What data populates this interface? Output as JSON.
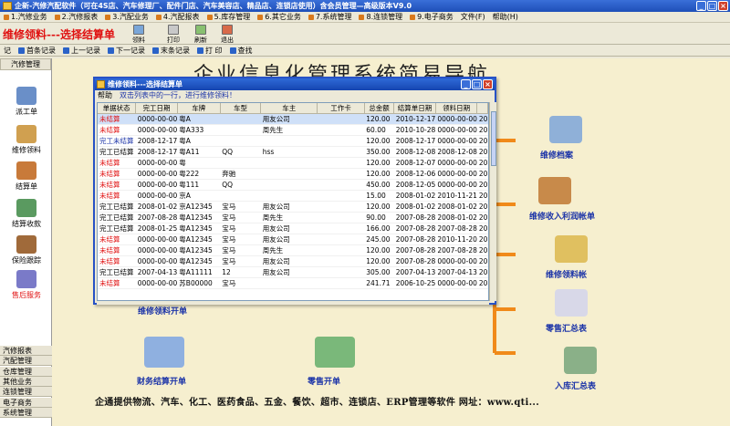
{
  "window": {
    "title": "企新-汽修汽配软件（可在4S店、汽车修理厂、配件门店、汽车美容店、精品店、连锁店使用）含会员管理—高级版本V9.0"
  },
  "menu": [
    {
      "label": "1.汽修业务"
    },
    {
      "label": "2.汽修报表"
    },
    {
      "label": "3.汽配业务"
    },
    {
      "label": "4.汽配报表"
    },
    {
      "label": "5.库存管理"
    },
    {
      "label": "6.其它业务"
    },
    {
      "label": "7.系统管理"
    },
    {
      "label": "8.连锁管理"
    },
    {
      "label": "9.电子商务"
    },
    {
      "label": "文件(F)",
      "plain": true
    },
    {
      "label": "帮助(H)",
      "plain": true
    }
  ],
  "toolbar": {
    "banner": "维修领料---选择结算单",
    "buttons": [
      {
        "label": "领料",
        "icon": "pick-material-icon"
      },
      {
        "label": "打印",
        "icon": "print-icon"
      },
      {
        "label": "刷新",
        "icon": "refresh-icon"
      },
      {
        "label": "退出",
        "icon": "exit-icon"
      }
    ]
  },
  "navbar": [
    {
      "label": "记",
      "plain": true
    },
    {
      "label": "首条记录"
    },
    {
      "label": "上一记录"
    },
    {
      "label": "下一记录"
    },
    {
      "label": "末条记录"
    },
    {
      "label": "打 印"
    },
    {
      "label": "查找"
    }
  ],
  "sidebar": {
    "header": "汽修管理",
    "items": [
      {
        "label": "派工单",
        "icon": "dispatch-icon"
      },
      {
        "label": "维修领料",
        "icon": "material-icon"
      },
      {
        "label": "结算单",
        "icon": "settle-icon"
      },
      {
        "label": "结算收款",
        "icon": "payment-icon"
      },
      {
        "label": "保险跟踪",
        "icon": "insurance-icon"
      },
      {
        "label": "售后服务",
        "icon": "aftersales-icon"
      }
    ],
    "footer": [
      "汽修报表",
      "汽配管理",
      "仓库管理",
      "其他业务",
      "连锁管理",
      "电子商务",
      "系统管理"
    ]
  },
  "main": {
    "title": "企业信息化管理系统简易导航",
    "right_items": [
      "维修档案",
      "维修收入利润帐单",
      "维修领料帐",
      "零售汇总表",
      "入库汇总表"
    ],
    "bottom_items": [
      "财务结算开单",
      "零售开单"
    ],
    "partial_label": "维修领料开单",
    "bottom_text": "企通提供物流、汽车、化工、医药食品、五金、餐饮、超市、连锁店、ERP管理等软件  网址：www.qti..."
  },
  "dialog": {
    "title": "维修领料---选择结算单",
    "menu_help": "帮助",
    "menu_hint": "双击列表中的一行，进行维修领料！",
    "columns": [
      "单据状态",
      "完工日期",
      "车牌",
      "车型",
      "车主",
      "工作卡",
      "总金额",
      "结算单日期",
      "领料日期",
      ""
    ],
    "rows": [
      {
        "status": "未结算",
        "color": "red",
        "done": "0000-00-00",
        "plate": "粤A",
        "model": "",
        "owner": "用友公司",
        "card": "",
        "total": "120.00",
        "settle": "2010-12-17",
        "pick": "0000-00-00",
        "extra": "20"
      },
      {
        "status": "未结算",
        "color": "red",
        "done": "0000-00-00",
        "plate": "粤A333",
        "model": "",
        "owner": "周先生",
        "card": "",
        "total": "60.00",
        "settle": "2010-10-28",
        "pick": "0000-00-00",
        "extra": "20"
      },
      {
        "status": "完工未结算",
        "color": "blue",
        "done": "2008-12-17",
        "plate": "粤A",
        "model": "",
        "owner": "",
        "card": "",
        "total": "120.00",
        "settle": "2008-12-17",
        "pick": "0000-00-00",
        "extra": "20"
      },
      {
        "status": "完工已结算",
        "color": "black",
        "done": "2008-12-17",
        "plate": "粤A11",
        "model": "QQ",
        "owner": "hss",
        "card": "",
        "total": "350.00",
        "settle": "2008-12-08",
        "pick": "2008-12-08",
        "extra": "20"
      },
      {
        "status": "未结算",
        "color": "red",
        "done": "0000-00-00",
        "plate": "粤",
        "model": "",
        "owner": "",
        "card": "",
        "total": "120.00",
        "settle": "2008-12-07",
        "pick": "0000-00-00",
        "extra": "20"
      },
      {
        "status": "未结算",
        "color": "red",
        "done": "0000-00-00",
        "plate": "粤222",
        "model": "奔驰",
        "owner": "",
        "card": "",
        "total": "120.00",
        "settle": "2008-12-06",
        "pick": "0000-00-00",
        "extra": "20"
      },
      {
        "status": "未结算",
        "color": "red",
        "done": "0000-00-00",
        "plate": "粤111",
        "model": "QQ",
        "owner": "",
        "card": "",
        "total": "450.00",
        "settle": "2008-12-05",
        "pick": "0000-00-00",
        "extra": "20"
      },
      {
        "status": "未结算",
        "color": "red",
        "done": "0000-00-00",
        "plate": "京A",
        "model": "",
        "owner": "",
        "card": "",
        "total": "15.00",
        "settle": "2008-01-02",
        "pick": "2010-11-21",
        "extra": "20"
      },
      {
        "status": "完工已结算",
        "color": "black",
        "done": "2008-01-02",
        "plate": "京A12345",
        "model": "宝马",
        "owner": "用友公司",
        "card": "",
        "total": "120.00",
        "settle": "2008-01-02",
        "pick": "2008-01-02",
        "extra": "20"
      },
      {
        "status": "完工已结算",
        "color": "black",
        "done": "2007-08-28",
        "plate": "粤A12345",
        "model": "宝马",
        "owner": "周先生",
        "card": "",
        "total": "90.00",
        "settle": "2007-08-28",
        "pick": "2008-01-02",
        "extra": "20"
      },
      {
        "status": "完工已结算",
        "color": "black",
        "done": "2008-01-25",
        "plate": "粤A12345",
        "model": "宝马",
        "owner": "用友公司",
        "card": "",
        "total": "166.00",
        "settle": "2007-08-28",
        "pick": "2007-08-28",
        "extra": "20"
      },
      {
        "status": "未结算",
        "color": "red",
        "done": "0000-00-00",
        "plate": "粤A12345",
        "model": "宝马",
        "owner": "用友公司",
        "card": "",
        "total": "245.00",
        "settle": "2007-08-28",
        "pick": "2010-11-20",
        "extra": "20"
      },
      {
        "status": "未结算",
        "color": "red",
        "done": "0000-00-00",
        "plate": "粤A12345",
        "model": "宝马",
        "owner": "周先生",
        "card": "",
        "total": "120.00",
        "settle": "2007-08-28",
        "pick": "2007-08-28",
        "extra": "20"
      },
      {
        "status": "未结算",
        "color": "red",
        "done": "0000-00-00",
        "plate": "粤A12345",
        "model": "宝马",
        "owner": "用友公司",
        "card": "",
        "total": "120.00",
        "settle": "2007-08-28",
        "pick": "0000-00-00",
        "extra": "20"
      },
      {
        "status": "完工已结算",
        "color": "black",
        "done": "2007-04-13",
        "plate": "粤A11111",
        "model": "12",
        "owner": "用友公司",
        "card": "",
        "total": "305.00",
        "settle": "2007-04-13",
        "pick": "2007-04-13",
        "extra": "20"
      },
      {
        "status": "未结算",
        "color": "red",
        "done": "0000-00-00",
        "plate": "苏B00000",
        "model": "宝马",
        "owner": "",
        "card": "",
        "total": "241.71",
        "settle": "2006-10-25",
        "pick": "0000-00-00",
        "extra": "20"
      }
    ]
  },
  "colors": {
    "status_red": "#e01010",
    "status_blue": "#1c34a8",
    "bracket": "#f08a1a",
    "title_blue": "#1e4fb8"
  }
}
